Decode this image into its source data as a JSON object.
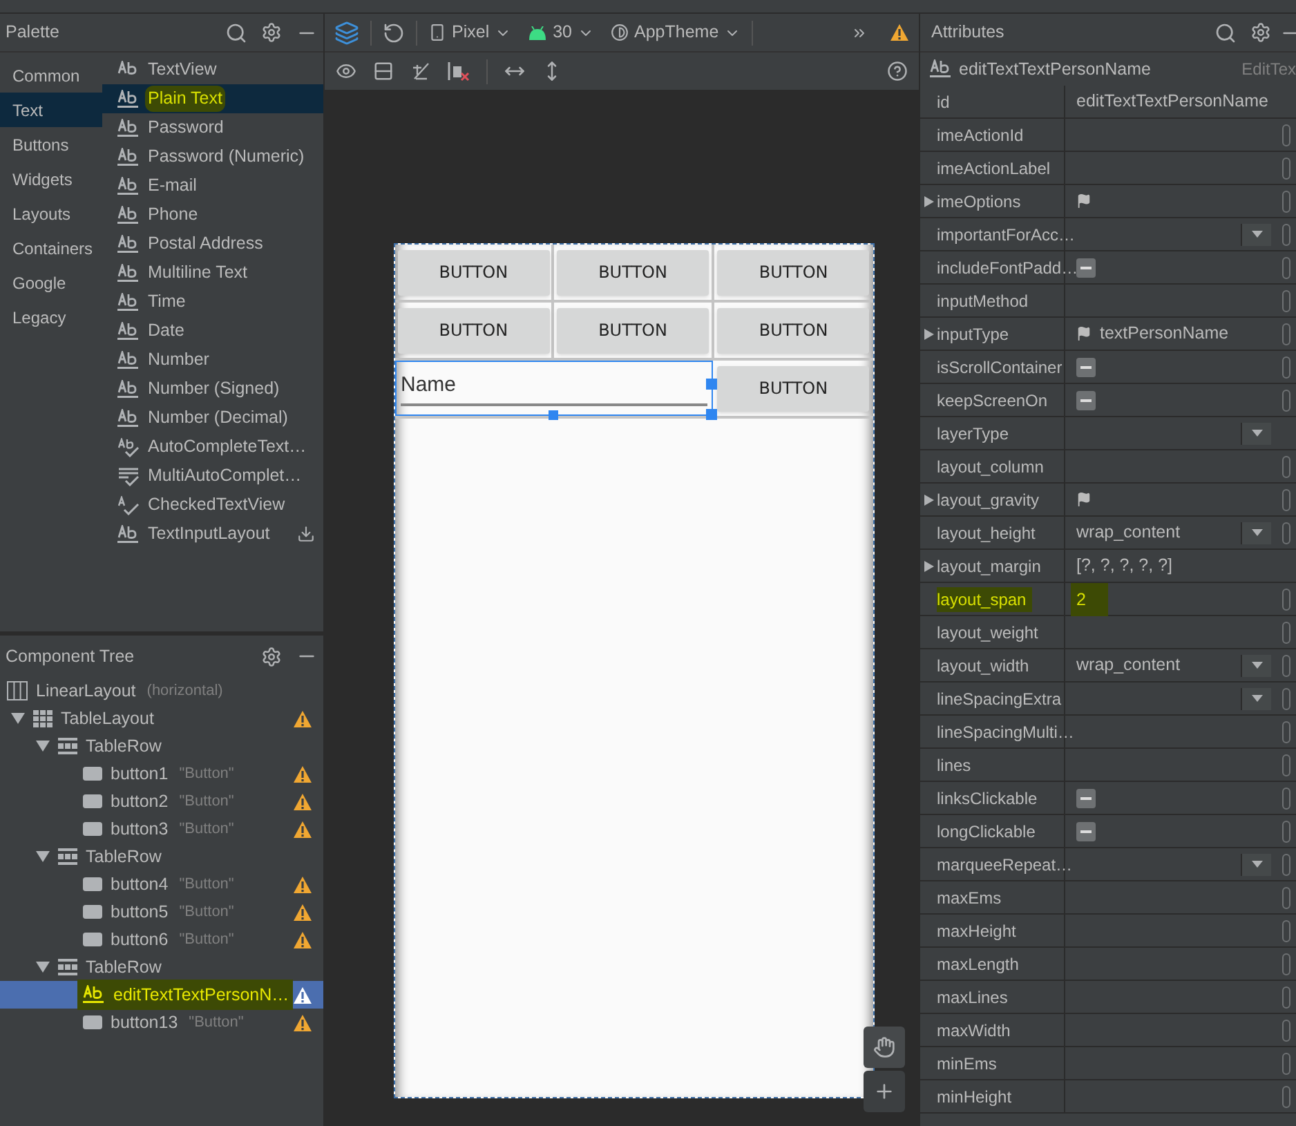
{
  "palette": {
    "title": "Palette",
    "categories": [
      {
        "label": "Common",
        "selected": false
      },
      {
        "label": "Text",
        "selected": true
      },
      {
        "label": "Buttons",
        "selected": false
      },
      {
        "label": "Widgets",
        "selected": false
      },
      {
        "label": "Layouts",
        "selected": false
      },
      {
        "label": "Containers",
        "selected": false
      },
      {
        "label": "Google",
        "selected": false
      },
      {
        "label": "Legacy",
        "selected": false
      }
    ],
    "items": [
      {
        "label": "TextView",
        "kind": "ab-plain",
        "selected": false,
        "highlighted": false,
        "download": false
      },
      {
        "label": "Plain Text",
        "kind": "ab",
        "selected": true,
        "highlighted": true,
        "download": false
      },
      {
        "label": "Password",
        "kind": "ab",
        "selected": false,
        "highlighted": false,
        "download": false
      },
      {
        "label": "Password (Numeric)",
        "kind": "ab",
        "selected": false,
        "highlighted": false,
        "download": false
      },
      {
        "label": "E-mail",
        "kind": "ab",
        "selected": false,
        "highlighted": false,
        "download": false
      },
      {
        "label": "Phone",
        "kind": "ab",
        "selected": false,
        "highlighted": false,
        "download": false
      },
      {
        "label": "Postal Address",
        "kind": "ab",
        "selected": false,
        "highlighted": false,
        "download": false
      },
      {
        "label": "Multiline Text",
        "kind": "ab",
        "selected": false,
        "highlighted": false,
        "download": false
      },
      {
        "label": "Time",
        "kind": "ab",
        "selected": false,
        "highlighted": false,
        "download": false
      },
      {
        "label": "Date",
        "kind": "ab",
        "selected": false,
        "highlighted": false,
        "download": false
      },
      {
        "label": "Number",
        "kind": "ab",
        "selected": false,
        "highlighted": false,
        "download": false
      },
      {
        "label": "Number (Signed)",
        "kind": "ab",
        "selected": false,
        "highlighted": false,
        "download": false
      },
      {
        "label": "Number (Decimal)",
        "kind": "ab",
        "selected": false,
        "highlighted": false,
        "download": false
      },
      {
        "label": "AutoCompleteText…",
        "kind": "ab-check",
        "selected": false,
        "highlighted": false,
        "download": false
      },
      {
        "label": "MultiAutoComplet…",
        "kind": "lines-check",
        "selected": false,
        "highlighted": false,
        "download": false
      },
      {
        "label": "CheckedTextView",
        "kind": "a-check",
        "selected": false,
        "highlighted": false,
        "download": false
      },
      {
        "label": "TextInputLayout",
        "kind": "ab",
        "selected": false,
        "highlighted": false,
        "download": true
      }
    ]
  },
  "toolbar": {
    "device": "Pixel",
    "api": "30",
    "theme": "AppTheme"
  },
  "design": {
    "rows": [
      [
        {
          "kind": "button",
          "label": "BUTTON",
          "selected": false
        },
        {
          "kind": "button",
          "label": "BUTTON",
          "selected": false
        },
        {
          "kind": "button",
          "label": "BUTTON",
          "selected": false
        }
      ],
      [
        {
          "kind": "button",
          "label": "BUTTON",
          "selected": false
        },
        {
          "kind": "button",
          "label": "BUTTON",
          "selected": false
        },
        {
          "kind": "button",
          "label": "BUTTON",
          "selected": false
        }
      ],
      [
        {
          "kind": "edittext",
          "label": "Name",
          "selected": true
        },
        "",
        {
          "kind": "button",
          "label": "BUTTON",
          "selected": false
        }
      ]
    ]
  },
  "component_tree": {
    "title": "Component Tree",
    "nodes": [
      {
        "label": "LinearLayout",
        "detail": "(horizontal)",
        "kind": "linear",
        "warning": false,
        "selected": false,
        "highlighted": false,
        "children": [
          {
            "label": "TableLayout",
            "kind": "table",
            "warning": true,
            "selected": false,
            "highlighted": false,
            "expanded": true,
            "children": [
              {
                "label": "TableRow",
                "kind": "row",
                "warning": false,
                "selected": false,
                "highlighted": false,
                "expanded": true,
                "children": [
                  {
                    "label": "button1",
                    "detail": "\"Button\"",
                    "kind": "button",
                    "warning": true,
                    "selected": false,
                    "highlighted": false
                  },
                  {
                    "label": "button2",
                    "detail": "\"Button\"",
                    "kind": "button",
                    "warning": true,
                    "selected": false,
                    "highlighted": false
                  },
                  {
                    "label": "button3",
                    "detail": "\"Button\"",
                    "kind": "button",
                    "warning": true,
                    "selected": false,
                    "highlighted": false
                  }
                ]
              },
              {
                "label": "TableRow",
                "kind": "row",
                "warning": false,
                "selected": false,
                "highlighted": false,
                "expanded": true,
                "children": [
                  {
                    "label": "button4",
                    "detail": "\"Button\"",
                    "kind": "button",
                    "warning": true,
                    "selected": false,
                    "highlighted": false
                  },
                  {
                    "label": "button5",
                    "detail": "\"Button\"",
                    "kind": "button",
                    "warning": true,
                    "selected": false,
                    "highlighted": false
                  },
                  {
                    "label": "button6",
                    "detail": "\"Button\"",
                    "kind": "button",
                    "warning": true,
                    "selected": false,
                    "highlighted": false
                  }
                ]
              },
              {
                "label": "TableRow",
                "kind": "row",
                "warning": false,
                "selected": false,
                "highlighted": false,
                "expanded": true,
                "children": [
                  {
                    "label": "editTextTextPersonN…",
                    "kind": "ab",
                    "warning": true,
                    "selected": true,
                    "highlighted": true
                  },
                  {
                    "label": "button13",
                    "detail": "\"Button\"",
                    "kind": "button",
                    "warning": true,
                    "selected": false,
                    "highlighted": false
                  }
                ]
              }
            ]
          }
        ]
      }
    ]
  },
  "attributes": {
    "title": "Attributes",
    "component": "editTextTextPersonName",
    "component_class": "EditTex",
    "rows": [
      {
        "name": "id",
        "value": "editTextTextPersonName",
        "kind": "text",
        "expandable": false,
        "picker": false,
        "highlighted": false
      },
      {
        "name": "imeActionId",
        "kind": "text",
        "expandable": false,
        "picker": true,
        "highlighted": false
      },
      {
        "name": "imeActionLabel",
        "kind": "text",
        "expandable": false,
        "picker": true,
        "highlighted": false
      },
      {
        "name": "imeOptions",
        "kind": "flag",
        "expandable": true,
        "picker": true,
        "highlighted": false
      },
      {
        "name": "importantForAcc…",
        "kind": "dropdown",
        "expandable": false,
        "picker": true,
        "highlighted": false
      },
      {
        "name": "includeFontPadd…",
        "kind": "checkbox",
        "expandable": false,
        "picker": true,
        "highlighted": false
      },
      {
        "name": "inputMethod",
        "kind": "text",
        "expandable": false,
        "picker": true,
        "highlighted": false
      },
      {
        "name": "inputType",
        "value": "textPersonName",
        "kind": "flag",
        "expandable": true,
        "picker": true,
        "highlighted": false
      },
      {
        "name": "isScrollContainer",
        "kind": "checkbox",
        "expandable": false,
        "picker": true,
        "highlighted": false
      },
      {
        "name": "keepScreenOn",
        "kind": "checkbox",
        "expandable": false,
        "picker": true,
        "highlighted": false
      },
      {
        "name": "layerType",
        "kind": "dropdown",
        "expandable": false,
        "picker": false,
        "highlighted": false
      },
      {
        "name": "layout_column",
        "kind": "text",
        "expandable": false,
        "picker": true,
        "highlighted": false
      },
      {
        "name": "layout_gravity",
        "kind": "flag",
        "expandable": true,
        "picker": true,
        "highlighted": false
      },
      {
        "name": "layout_height",
        "value": "wrap_content",
        "kind": "dropdown",
        "expandable": false,
        "picker": true,
        "highlighted": false
      },
      {
        "name": "layout_margin",
        "value": "[?, ?, ?, ?, ?]",
        "kind": "text",
        "expandable": true,
        "picker": false,
        "highlighted": false
      },
      {
        "name": "layout_span",
        "value": "2",
        "kind": "text",
        "expandable": false,
        "picker": true,
        "highlighted": true
      },
      {
        "name": "layout_weight",
        "kind": "text",
        "expandable": false,
        "picker": true,
        "highlighted": false
      },
      {
        "name": "layout_width",
        "value": "wrap_content",
        "kind": "dropdown",
        "expandable": false,
        "picker": true,
        "highlighted": false
      },
      {
        "name": "lineSpacingExtra",
        "kind": "dropdown",
        "expandable": false,
        "picker": true,
        "highlighted": false
      },
      {
        "name": "lineSpacingMulti…",
        "kind": "text",
        "expandable": false,
        "picker": true,
        "highlighted": false
      },
      {
        "name": "lines",
        "kind": "text",
        "expandable": false,
        "picker": true,
        "highlighted": false
      },
      {
        "name": "linksClickable",
        "kind": "checkbox",
        "expandable": false,
        "picker": true,
        "highlighted": false
      },
      {
        "name": "longClickable",
        "kind": "checkbox",
        "expandable": false,
        "picker": true,
        "highlighted": false
      },
      {
        "name": "marqueeRepeat…",
        "kind": "dropdown",
        "expandable": false,
        "picker": true,
        "highlighted": false
      },
      {
        "name": "maxEms",
        "kind": "text",
        "expandable": false,
        "picker": true,
        "highlighted": false
      },
      {
        "name": "maxHeight",
        "kind": "text",
        "expandable": false,
        "picker": true,
        "highlighted": false
      },
      {
        "name": "maxLength",
        "kind": "text",
        "expandable": false,
        "picker": true,
        "highlighted": false
      },
      {
        "name": "maxLines",
        "kind": "text",
        "expandable": false,
        "picker": true,
        "highlighted": false
      },
      {
        "name": "maxWidth",
        "kind": "text",
        "expandable": false,
        "picker": true,
        "highlighted": false
      },
      {
        "name": "minEms",
        "kind": "text",
        "expandable": false,
        "picker": true,
        "highlighted": false
      },
      {
        "name": "minHeight",
        "kind": "text",
        "expandable": false,
        "picker": true,
        "highlighted": false
      }
    ]
  }
}
